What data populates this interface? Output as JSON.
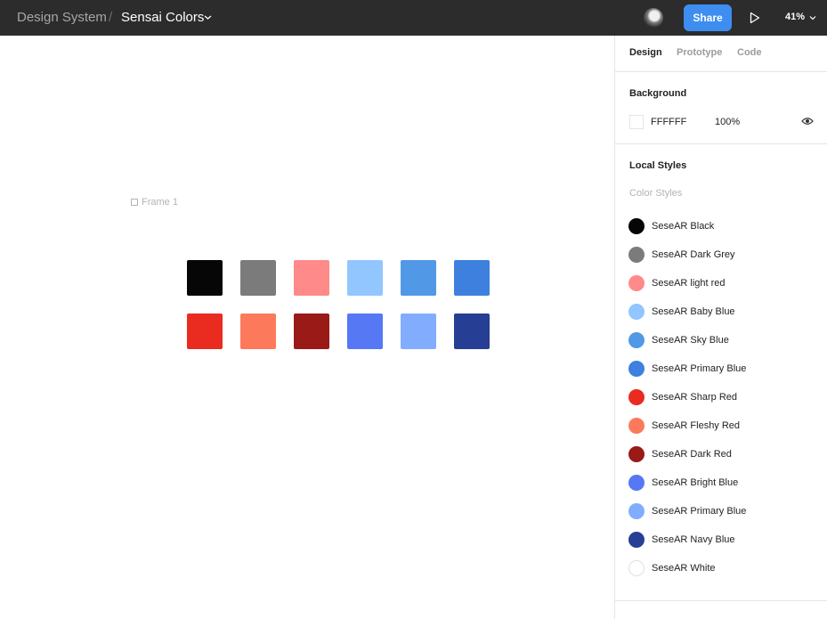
{
  "header": {
    "parent": "Design System",
    "separator": "/",
    "current": "Sensai Colors",
    "share_label": "Share",
    "zoom": "41%",
    "bar_color": "#2c2c2c",
    "accent_color": "#3d8ef0"
  },
  "canvas": {
    "frame_label": "Frame 1",
    "swatches_row1": [
      "#060606",
      "#7b7b7b",
      "#ff8a8a",
      "#91c6ff",
      "#5199e6",
      "#3e80de"
    ],
    "swatches_row2": [
      "#ea2b1f",
      "#fc7a5b",
      "#9a1a17",
      "#5678f5",
      "#82adff",
      "#263e94"
    ]
  },
  "panel": {
    "tabs": [
      "Design",
      "Prototype",
      "Code"
    ],
    "background": {
      "title": "Background",
      "hex": "FFFFFF",
      "opacity": "100%"
    },
    "local_styles": {
      "title": "Local Styles",
      "subtitle": "Color Styles",
      "items": [
        {
          "label": "SeseAR Black",
          "color": "#060606"
        },
        {
          "label": "SeseAR Dark Grey",
          "color": "#7b7b7b"
        },
        {
          "label": "SeseAR light red",
          "color": "#ff8a8a"
        },
        {
          "label": "SeseAR Baby Blue",
          "color": "#91c6ff"
        },
        {
          "label": "SeseAR Sky Blue",
          "color": "#5199e6"
        },
        {
          "label": "SeseAR Primary Blue",
          "color": "#3e80de"
        },
        {
          "label": "SeseAR Sharp Red",
          "color": "#ea2b1f"
        },
        {
          "label": "SeseAR Fleshy Red",
          "color": "#fc7a5b"
        },
        {
          "label": "SeseAR Dark Red",
          "color": "#9a1a17"
        },
        {
          "label": "SeseAR Bright Blue",
          "color": "#5678f5"
        },
        {
          "label": "SeseAR Primary Blue",
          "color": "#82adff"
        },
        {
          "label": "SeseAR Navy Blue",
          "color": "#263e94"
        },
        {
          "label": "SeseAR White",
          "color": "#ffffff"
        }
      ]
    }
  }
}
